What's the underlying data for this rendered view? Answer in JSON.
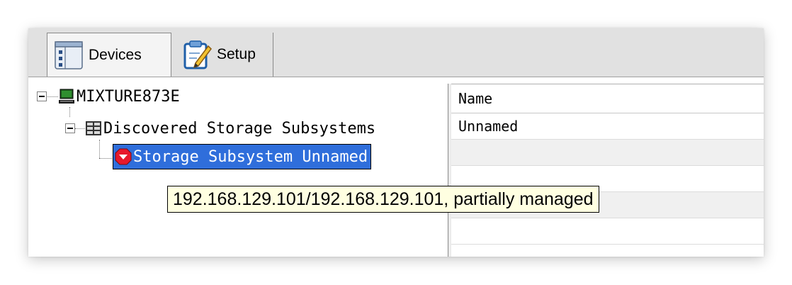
{
  "tabs": [
    {
      "label": "Devices",
      "icon": "devices-list-icon",
      "active": true
    },
    {
      "label": "Setup",
      "icon": "setup-clipboard-icon",
      "active": false
    }
  ],
  "tree": {
    "root": {
      "label": "MIXTURE873E",
      "icon": "computer-icon",
      "expanded": true
    },
    "group": {
      "label": "Discovered Storage Subsystems",
      "icon": "storage-array-icon",
      "expanded": true
    },
    "item": {
      "label": "Storage Subsystem Unnamed",
      "icon": "error-status-icon",
      "selected": true
    }
  },
  "tooltip": {
    "text": "192.168.129.101/192.168.129.101, partially managed"
  },
  "table": {
    "header": "Name",
    "rows": [
      "Unnamed",
      "",
      "",
      "",
      ""
    ]
  },
  "colors": {
    "selection": "#2f6edb",
    "tooltip_bg": "#ffffe1",
    "error": "#e8192c"
  }
}
